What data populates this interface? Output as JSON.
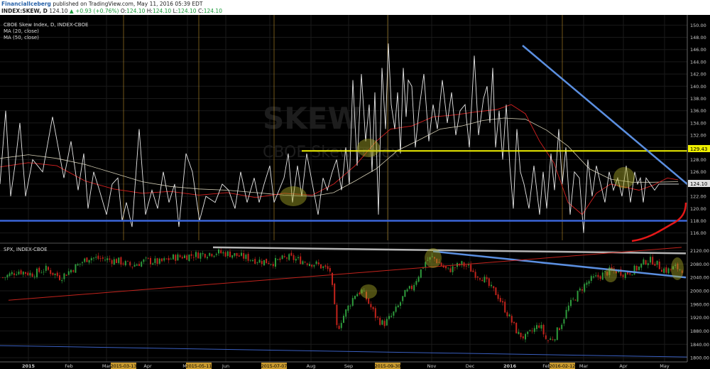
{
  "header": {
    "author": "FinancialIceberg",
    "published_text": " published on TradingView.com, May 11, 2016 05:39 EDT"
  },
  "quote": {
    "symbol": "INDEX:SKEW, D",
    "last": "124.10",
    "change": "+0.93 (+0.76%)",
    "o_label": "O:",
    "o": "124.10",
    "h_label": "H:",
    "h": "124.10",
    "l_label": "L:",
    "l": "124.10",
    "c_label": "C:",
    "c": "124.10"
  },
  "colors": {
    "background": "#000000",
    "skew_line": "#e8e8e8",
    "ma20": "#d62020",
    "ma50": "#cfc9b0",
    "yellow_level": "#f0f000",
    "blue_level": "#3a66d9",
    "trendline_blue": "#5b8fe0",
    "trendline_gray": "#b5b5b5",
    "candle_up": "#2e9b3c",
    "candle_down": "#c2231c",
    "highlight_fill": "rgba(170,170,40,0.45)",
    "date_highlight": "#c99a2e"
  },
  "chart_data": [
    {
      "type": "line",
      "title": "CBOE Skew Index, D, INDEX-CBOE",
      "watermark_symbol": "SKEW",
      "watermark_name": "CBOE Skew Index",
      "legend": [
        "MA (20, close)",
        "MA (50, close)"
      ],
      "ylim": [
        114.8,
        151.2
      ],
      "y_ticks": [
        "116.00",
        "118.00",
        "120.00",
        "122.00",
        "124.00",
        "126.00",
        "128.00",
        "130.00",
        "132.00",
        "134.00",
        "136.00",
        "138.00",
        "140.00",
        "142.00",
        "144.00",
        "146.00",
        "148.00",
        "150.00"
      ],
      "y_tick_values": [
        116,
        118,
        120,
        122,
        124,
        126,
        128,
        130,
        132,
        134,
        136,
        138,
        140,
        142,
        144,
        146,
        148,
        150
      ],
      "price_label": "124.10",
      "level_label": "129.43",
      "levels": {
        "yellow": 129.43,
        "blue": 118.0
      },
      "series": [
        {
          "name": "SKEW",
          "x": [
            0,
            8,
            15,
            21,
            28,
            36,
            46,
            60,
            74,
            90,
            100,
            110,
            118,
            124,
            132,
            140,
            150,
            158,
            166,
            172,
            178,
            186,
            196,
            205,
            214,
            222,
            230,
            238,
            246,
            252,
            262,
            271,
            281,
            290,
            303,
            313,
            322,
            331,
            339,
            348,
            358,
            365,
            372,
            380,
            386,
            393,
            400,
            406,
            412,
            419,
            425,
            432,
            440,
            448,
            455,
            461,
            468,
            474,
            481,
            487,
            492,
            497,
            503,
            509,
            515,
            520,
            524,
            528,
            533,
            538,
            543,
            547,
            551,
            556,
            560,
            564,
            568,
            572,
            575,
            580,
            585,
            590,
            597,
            604,
            610,
            616,
            623,
            630,
            636,
            642,
            648,
            655,
            661,
            668,
            674,
            681,
            686,
            690,
            694,
            698,
            703,
            708,
            713,
            718,
            723,
            728,
            733,
            738,
            745,
            752,
            760,
            765,
            770,
            776,
            781,
            787,
            792,
            797,
            803,
            809,
            816,
            822,
            828,
            834,
            840,
            846,
            852,
            858,
            864,
            870,
            876,
            882,
            888,
            894,
            898,
            902,
            906,
            910,
            916,
            922,
            928,
            934,
            940,
            946,
            952,
            956
          ],
          "values": [
            124,
            136,
            122,
            127,
            134,
            122,
            128,
            126,
            135,
            125,
            131,
            123,
            129,
            120,
            126,
            123,
            119,
            124,
            125,
            118,
            121,
            117,
            133,
            119,
            123,
            120,
            126,
            121,
            124,
            117,
            129,
            126,
            118,
            122,
            121,
            124,
            123,
            120,
            126,
            121,
            125,
            121,
            124,
            127,
            121,
            123,
            125,
            129,
            121,
            127,
            122,
            129,
            124,
            119,
            125,
            123,
            126,
            128,
            123,
            130,
            124,
            141,
            127,
            142,
            131,
            137,
            126,
            139,
            119,
            143,
            133,
            147,
            137,
            133,
            139,
            129,
            143,
            135,
            141,
            140,
            130,
            136,
            142,
            131,
            137,
            133,
            141,
            134,
            139,
            132,
            136,
            137,
            130,
            145,
            132,
            138,
            140,
            134,
            143,
            130,
            136,
            128,
            137,
            127,
            120,
            133,
            126,
            124,
            120,
            127,
            119,
            126,
            120,
            129,
            123,
            133,
            124,
            130,
            119,
            126,
            125,
            116,
            128,
            122,
            127,
            124,
            121,
            126,
            123,
            125,
            122,
            127,
            121,
            126,
            124,
            125,
            121,
            125,
            124,
            123,
            124,
            124,
            124,
            124,
            124,
            124
          ]
        },
        {
          "name": "MA (20, close)",
          "x": [
            0,
            40,
            80,
            120,
            160,
            200,
            240,
            280,
            320,
            360,
            400,
            440,
            470,
            500,
            530,
            550,
            580,
            610,
            640,
            670,
            700,
            720,
            740,
            760,
            780,
            800,
            820,
            840,
            860,
            880,
            900,
            920,
            940,
            955
          ],
          "values": [
            126.8,
            127.5,
            127,
            124.5,
            123.2,
            122.5,
            122.8,
            122.2,
            122.6,
            121.8,
            122.5,
            122.2,
            124,
            127,
            131,
            133,
            133.5,
            135,
            135.3,
            135.8,
            136.2,
            137,
            135.5,
            131,
            127.5,
            121,
            119,
            122.5,
            124,
            123.5,
            123,
            123.8,
            125,
            124.7
          ]
        },
        {
          "name": "MA (50, close)",
          "x": [
            0,
            40,
            80,
            120,
            160,
            200,
            240,
            280,
            320,
            360,
            400,
            440,
            470,
            500,
            530,
            560,
            590,
            620,
            650,
            680,
            710,
            740,
            770,
            800,
            830,
            860,
            890,
            920,
            955
          ],
          "values": [
            128.2,
            128.8,
            128.2,
            127.2,
            125.8,
            124.4,
            123.6,
            123.2,
            123,
            122.6,
            122.2,
            122,
            122.6,
            124.5,
            126.5,
            129.5,
            131.2,
            133,
            133.5,
            134.4,
            134.8,
            134.6,
            132.8,
            130.2,
            126.5,
            124.8,
            124.3,
            124.3,
            124.4
          ]
        }
      ]
    },
    {
      "type": "candlestick",
      "title": "SPX, INDEX-CBOE",
      "ylim": [
        1796,
        2134
      ],
      "y_ticks": [
        "1800.00",
        "1840.00",
        "1880.00",
        "1920.00",
        "1960.00",
        "2000.00",
        "2040.00",
        "2080.00",
        "2120.00"
      ],
      "y_tick_values": [
        1800,
        1840,
        1880,
        1920,
        1960,
        2000,
        2040,
        2080,
        2120
      ],
      "x_axis_labels": [
        "2015",
        "Feb",
        "Mar",
        "Apr",
        "May",
        "Jun",
        "Jul",
        "Aug",
        "Sep",
        "Oct",
        "Nov",
        "Dec",
        "2016",
        "Feb",
        "Mar",
        "Apr",
        "May"
      ],
      "x_axis_highlighted_dates": [
        "2015-03-13",
        "2015-05-11",
        "2015-07-07",
        "2015-09-30",
        "2016-02-12"
      ],
      "close_path": {
        "x": [
          5,
          25,
          45,
          65,
          85,
          105,
          125,
          145,
          165,
          185,
          205,
          225,
          245,
          265,
          285,
          305,
          325,
          345,
          365,
          385,
          405,
          425,
          445,
          465,
          475,
          480,
          490,
          500,
          510,
          520,
          530,
          540,
          550,
          560,
          570,
          580,
          590,
          600,
          610,
          620,
          630,
          640,
          650,
          660,
          670,
          680,
          690,
          700,
          710,
          720,
          730,
          740,
          750,
          760,
          770,
          780,
          790,
          800,
          810,
          820,
          830,
          840,
          850,
          860,
          870,
          880,
          890,
          900,
          910,
          920,
          930,
          940,
          950,
          960
        ],
        "values": [
          2040,
          2060,
          2050,
          2065,
          2040,
          2070,
          2100,
          2095,
          2090,
          2075,
          2090,
          2085,
          2100,
          2105,
          2110,
          2115,
          2110,
          2100,
          2090,
          2085,
          2100,
          2090,
          2080,
          2060,
          1880,
          1910,
          1950,
          1990,
          2000,
          1960,
          1920,
          1900,
          1920,
          1950,
          1990,
          2010,
          2050,
          2090,
          2100,
          2080,
          2060,
          2070,
          2080,
          2070,
          2050,
          2040,
          2010,
          1990,
          1950,
          1910,
          1870,
          1860,
          1880,
          1900,
          1850,
          1860,
          1900,
          1950,
          1980,
          2010,
          2030,
          2040,
          2050,
          2060,
          2060,
          2050,
          2060,
          2070,
          2090,
          2090,
          2070,
          2060,
          2070,
          2065
        ]
      },
      "trendlines": [
        {
          "name": "gray-resistance",
          "from": [
            "2015-05-11",
            2130
          ],
          "to": [
            "2016-05",
            2112
          ]
        },
        {
          "name": "blue-descending",
          "from": [
            "2015-11",
            2118
          ],
          "to": [
            "2016-05",
            2040
          ]
        },
        {
          "name": "red-long-term",
          "from": [
            "2015",
            1972
          ],
          "to": [
            "2016-05",
            2130
          ]
        },
        {
          "name": "blue-long-term",
          "from": [
            "2015",
            1836
          ],
          "to": [
            "2016-05",
            1802
          ]
        }
      ]
    }
  ]
}
